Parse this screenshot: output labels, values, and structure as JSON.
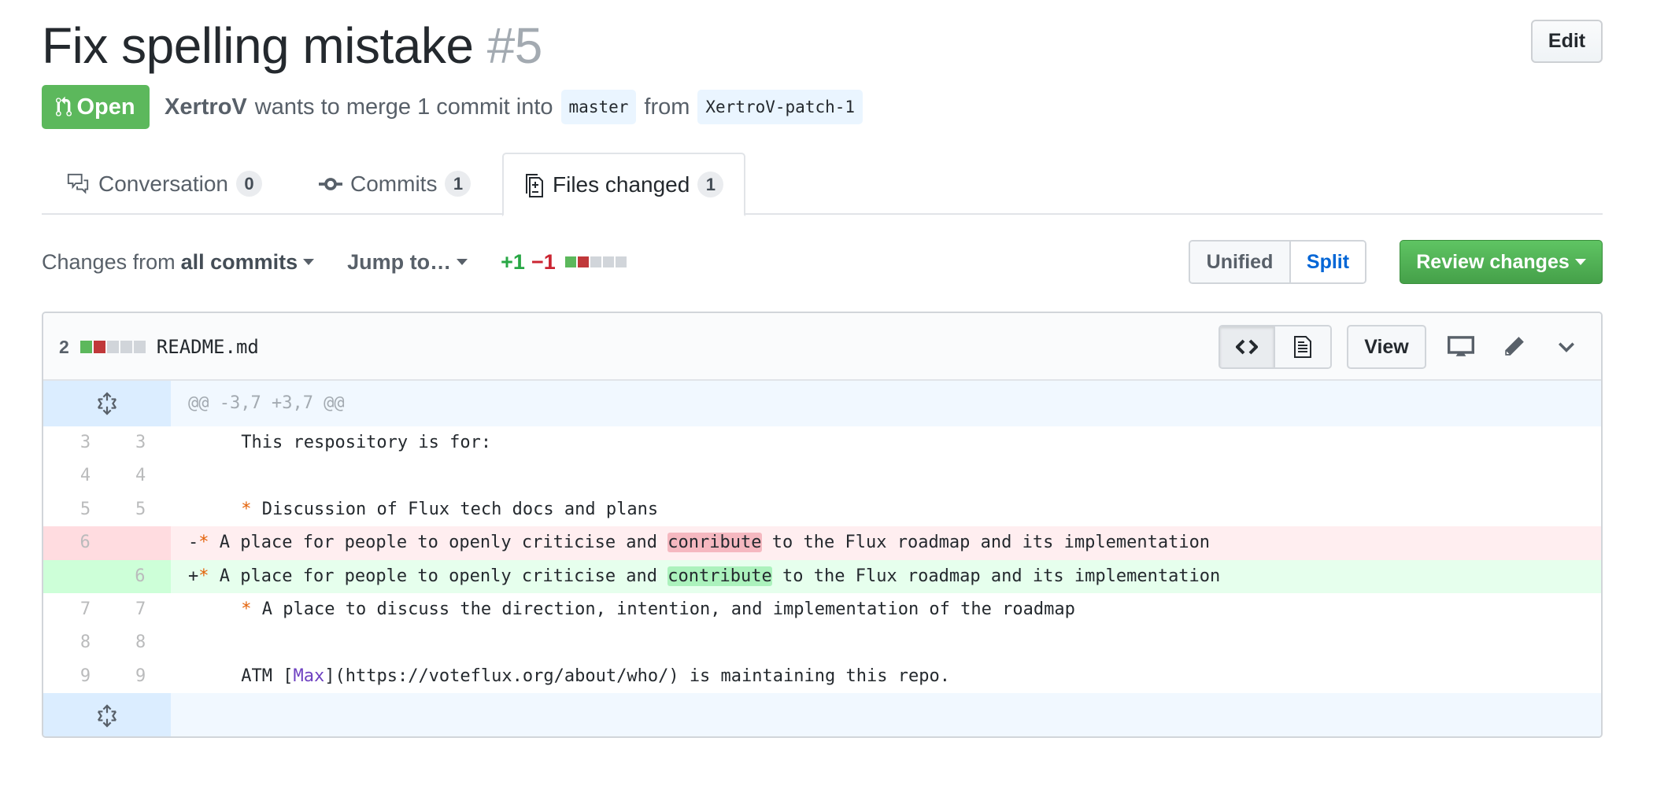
{
  "pr": {
    "title": "Fix spelling mistake",
    "number": "#5",
    "edit_label": "Edit",
    "state_label": "Open",
    "state_color": "#5cb85c",
    "author": "XertroV",
    "merge_text": "wants to merge 1 commit into",
    "base_branch": "master",
    "from_text": "from",
    "head_branch": "XertroV-patch-1"
  },
  "tabs": [
    {
      "label": "Conversation",
      "count": "0",
      "icon": "comment-discussion-icon"
    },
    {
      "label": "Commits",
      "count": "1",
      "icon": "git-commit-icon"
    },
    {
      "label": "Files changed",
      "count": "1",
      "icon": "file-diff-icon",
      "active": true
    }
  ],
  "toolbar": {
    "changes_prefix": "Changes from",
    "changes_value": "all commits",
    "jump_label": "Jump to…",
    "additions": "+1",
    "deletions": "−1",
    "diffstat": [
      "add",
      "del",
      "neutral",
      "neutral",
      "neutral"
    ],
    "unified_label": "Unified",
    "split_label": "Split",
    "review_label": "Review changes"
  },
  "file": {
    "changes": "2",
    "name": "README.md",
    "view_label": "View",
    "hunk_header": "@@ -3,7 +3,7 @@",
    "lines": [
      {
        "old": "3",
        "new": "3",
        "type": "context",
        "text": " This respository is for:"
      },
      {
        "old": "4",
        "new": "4",
        "type": "context",
        "text": ""
      },
      {
        "old": "5",
        "new": "5",
        "type": "context",
        "prefix": " ",
        "text": " Discussion of Flux tech docs and plans"
      },
      {
        "old": "6",
        "new": "",
        "type": "del",
        "before": " A place for people to openly criticise and ",
        "changed": "conribute",
        "after": " to the Flux roadmap and its implementation"
      },
      {
        "old": "",
        "new": "6",
        "type": "add",
        "before": " A place for people to openly criticise and ",
        "changed": "contribute",
        "after": " to the Flux roadmap and its implementation"
      },
      {
        "old": "7",
        "new": "7",
        "type": "context",
        "text": " A place to discuss the direction, intention, and implementation of the roadmap"
      },
      {
        "old": "8",
        "new": "8",
        "type": "context",
        "text": ""
      },
      {
        "old": "9",
        "new": "9",
        "type": "context",
        "pre": " ATM [",
        "link": "Max",
        "post": "](https://voteflux.org/about/who/) is maintaining this repo."
      }
    ]
  }
}
